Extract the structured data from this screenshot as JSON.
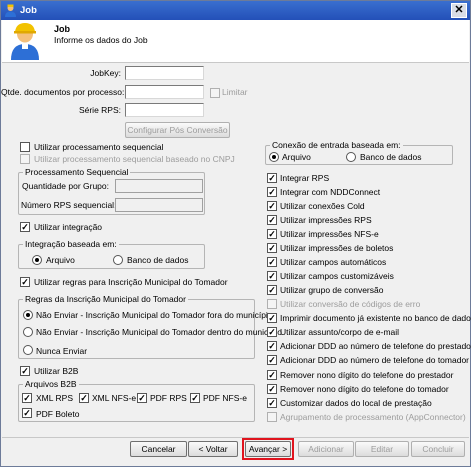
{
  "window": {
    "title": "Job",
    "close_glyph": "✕"
  },
  "header": {
    "title": "Job",
    "subtitle": "Informe os dados do Job"
  },
  "form": {
    "jobkey_label": "JobKey:",
    "qtde_label": "Qtde. documentos por processo:",
    "limitar_label": "Limitar",
    "serie_label": "Série RPS:",
    "config_pos_button": "Configurar Pós Conversão"
  },
  "left": {
    "proc_seq": "Utilizar processamento sequencial",
    "proc_seq_cnpj": "Utilizar processamento sequencial baseado no CNPJ",
    "grp_proc_seq": "Processamento Sequencial",
    "qtd_grupo": "Quantidade por Grupo:",
    "num_rps_seq": "Número RPS sequencial:",
    "utilizar_integracao": "Utilizar integração",
    "grp_integracao": "Integração baseada em:",
    "int_arquivo": "Arquivo",
    "int_banco": "Banco de dados",
    "regras_inscricao": "Utilizar regras para Inscrição Municipal do Tomador",
    "grp_regras": "Regras da Inscrição Municipal do Tomador",
    "regra_1": "Não Enviar - Inscrição Municipal do Tomador fora do município",
    "regra_2": "Não Enviar - Inscrição Municipal do Tomador dentro do município",
    "regra_3": "Nunca Enviar",
    "utilizar_b2b": "Utilizar B2B",
    "grp_arquivos_b2b": "Arquivos B2B",
    "xml_rps": "XML RPS",
    "xml_nfse": "XML NFS-e",
    "pdf_rps": "PDF RPS",
    "pdf_nfse": "PDF NFS-e",
    "pdf_boleto": "PDF Boleto"
  },
  "right": {
    "grp_conexao": "Conexão de entrada baseada em:",
    "con_arquivo": "Arquivo",
    "con_banco": "Banco de dados",
    "items": [
      "Integrar RPS",
      "Integrar com NDDConnect",
      "Utilizar conexões Cold",
      "Utilizar impressões RPS",
      "Utilizar impressões NFS-e",
      "Utilizar impressões de boletos",
      "Utilizar campos automáticos",
      "Utilizar campos customizáveis",
      "Utilizar grupo de conversão",
      "Utilizar conversão de códigos de erro",
      "Imprimir documento já existente no banco de dados",
      "Utilizar assunto/corpo de e-mail",
      "Adicionar DDD ao número de telefone do prestador",
      "Adicionar DDD ao número de telefone do tomador",
      "Remover nono dígito do telefone do prestador",
      "Remover nono dígito do telefone do tomador",
      "Customizar dados do local de prestação",
      "Agrupamento de processamento (AppConnector)"
    ]
  },
  "footer": {
    "cancelar": "Cancelar",
    "voltar": "< Voltar",
    "avancar": "Avançar >",
    "adicionar": "Adicionar",
    "editar": "Editar",
    "concluir": "Concluir"
  },
  "check_glyph": "✓"
}
